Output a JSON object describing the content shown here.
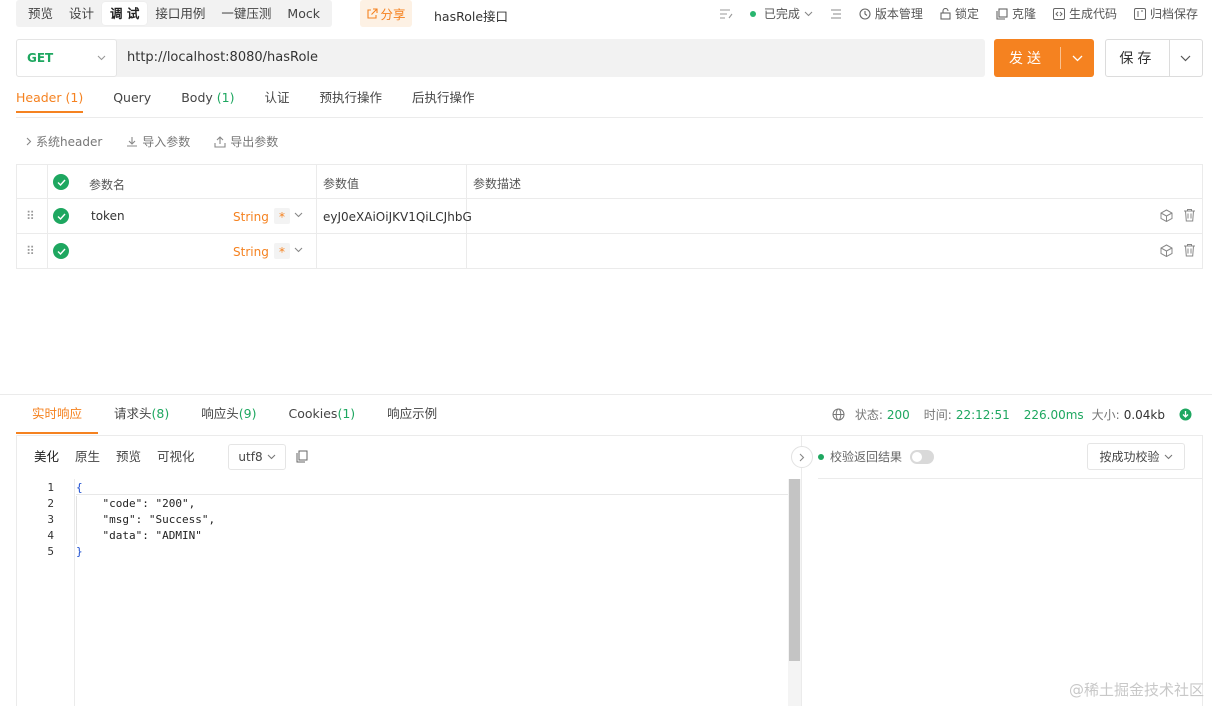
{
  "top_tabs": [
    "预览",
    "设计",
    "调 试",
    "接口用例",
    "一键压测",
    "Mock"
  ],
  "share_label": "分享",
  "api_name": "hasRole接口",
  "right_tools": {
    "status": "已完成",
    "version": "版本管理",
    "lock": "锁定",
    "clone": "克隆",
    "gen_code": "生成代码",
    "archive": "归档保存"
  },
  "request": {
    "method": "GET",
    "url": "http://localhost:8080/hasRole",
    "send_label": "发送",
    "save_label": "保存"
  },
  "req_tabs": [
    {
      "label": "Header ",
      "count": "(1)"
    },
    {
      "label": "Query",
      "count": ""
    },
    {
      "label": "Body ",
      "count": "(1)"
    },
    {
      "label": "认证",
      "count": ""
    },
    {
      "label": "预执行操作",
      "count": ""
    },
    {
      "label": "后执行操作",
      "count": ""
    }
  ],
  "sub_tools": {
    "system_header": "系统header",
    "import": "导入参数",
    "export": "导出参数"
  },
  "param_table": {
    "headers": [
      "参数名",
      "参数值",
      "参数描述"
    ],
    "rows": [
      {
        "name": "token",
        "type": "String",
        "required": "*",
        "value": "eyJ0eXAiOiJKV1QiLCJhbG",
        "desc": ""
      },
      {
        "name": "",
        "type": "String",
        "required": "*",
        "value": "",
        "desc": ""
      }
    ]
  },
  "resp_tabs": [
    {
      "label": "实时响应",
      "count": ""
    },
    {
      "label": "请求头",
      "count": "(8)"
    },
    {
      "label": "响应头",
      "count": "(9)"
    },
    {
      "label": "Cookies",
      "count": "(1)"
    },
    {
      "label": "响应示例",
      "count": ""
    }
  ],
  "status_info": {
    "status_label": "状态:",
    "status_value": "200",
    "time_label": "时间:",
    "time_value": "22:12:51",
    "duration": "226.00ms",
    "size_label": "大小:",
    "size_value": "0.04kb"
  },
  "format_tabs": [
    "美化",
    "原生",
    "预览",
    "可视化"
  ],
  "encoding": "utf8",
  "code_lines": [
    "{",
    "    \"code\": \"200\",",
    "    \"msg\": \"Success\",",
    "    \"data\": \"ADMIN\"",
    "}"
  ],
  "line_numbers": [
    "1",
    "2",
    "3",
    "4",
    "5"
  ],
  "validate_label": "校验返回结果",
  "rule_select": "按成功校验",
  "watermark": "@稀土掘金技术社区",
  "colors": {
    "accent": "#f58220",
    "success": "#1ea760"
  }
}
